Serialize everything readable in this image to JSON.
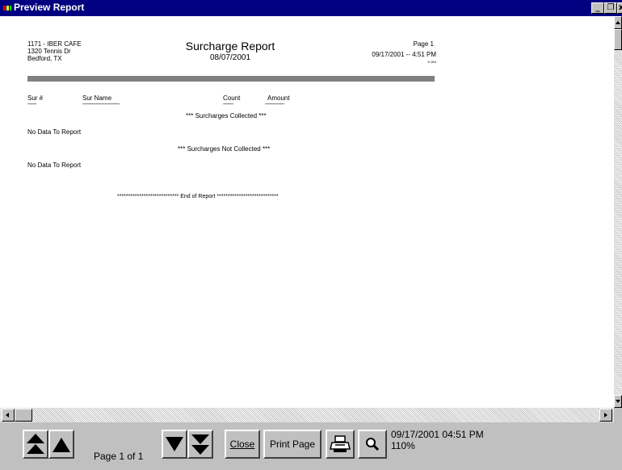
{
  "window": {
    "title": "Preview Report"
  },
  "report": {
    "store_line1": "1171 - IBER CAFE",
    "store_line2": "1320 Tennis Dr",
    "store_line3": "Bedford, TX",
    "title": "Surcharge Report",
    "date": "08/07/2001",
    "page_label": "Page 1",
    "printed_datetime": "09/17/2001 --   4:51 PM",
    "version": "5.1B4",
    "columns": {
      "sur_num": "Sur #",
      "sur_name": "Sur Name",
      "count": "Count",
      "amount": "Amount"
    },
    "dashes": {
      "sur_num": "------",
      "sur_name": "-------------------------",
      "count": "-------",
      "amount": "-------------"
    },
    "collected_header": "*** Surcharges Collected ***",
    "collected_nodata": "No Data To Report",
    "not_collected_header": "*** Surcharges Not Collected ***",
    "not_collected_nodata": "No Data To Report",
    "end_of_report": "****************************   End of Report   ****************************"
  },
  "toolbar": {
    "page_info": "Page 1 of 1",
    "close_label": "Close",
    "print_page_label": "Print Page",
    "status_datetime": "09/17/2001 04:51 PM",
    "zoom": "110%"
  }
}
